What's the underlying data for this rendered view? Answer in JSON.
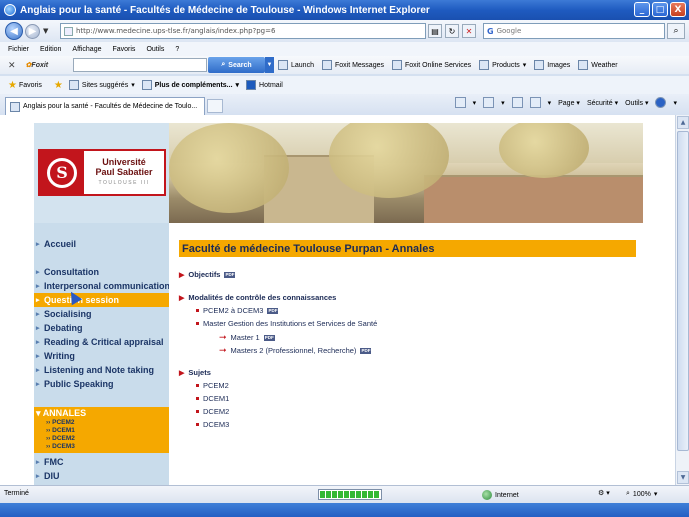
{
  "window": {
    "title": "Anglais pour la santé - Facultés de Médecine de Toulouse - Windows Internet Explorer",
    "min_glyph": "_",
    "max_glyph": "□",
    "close_glyph": "X"
  },
  "addressbar": {
    "url": "http://www.medecine.ups-tlse.fr/anglais/index.php?pg=6",
    "search_placeholder": "Google"
  },
  "menu": [
    "Fichier",
    "Edition",
    "Affichage",
    "Favoris",
    "Outils",
    "?"
  ],
  "foxit": {
    "logo": "Foxit",
    "search_label": "Search",
    "items": [
      "Launch",
      "Foxit Messages",
      "Foxit Online Services",
      "Products",
      "Images",
      "Weather"
    ]
  },
  "favorites": {
    "label": "Favoris",
    "items": [
      "Sites suggérés",
      "Plus de compléments...",
      "Hotmail"
    ]
  },
  "tab": {
    "label": "Anglais pour la santé - Facultés de Médecine de Toulo..."
  },
  "commandbar": [
    "Page",
    "Sécurité",
    "Outils"
  ],
  "logo": {
    "line1": "Université",
    "line2": "Paul Sabatier",
    "line3": "TOULOUSE III",
    "seal_letter": "S"
  },
  "nav": {
    "home": "Accueil",
    "items": [
      "Consultation",
      "Interpersonal communication",
      "Question session",
      "Socialising",
      "Debating",
      "Reading & Critical appraisal",
      "Writing",
      "Listening and Note taking",
      "Public Speaking"
    ],
    "active_index": 2,
    "annales": {
      "title": "ANNALES",
      "items": [
        "›› PCEM2",
        "›› DCEM1",
        "›› DCEM2",
        "›› DCEM3"
      ]
    },
    "bottom": [
      "FMC",
      "DIU"
    ]
  },
  "content": {
    "title": "Faculté de médecine Toulouse Purpan - Annales",
    "sections": {
      "objectifs": "Objectifs",
      "modalites": "Modalités de contrôle des connaissances",
      "pcem_dcem": "PCEM2 à DCEM3",
      "master_gestion": "Master Gestion des Institutions et Services de Santé",
      "master1": "Master 1",
      "masters2": "Masters 2 (Professionnel, Recherche)",
      "sujets": "Sujets",
      "sujets_items": [
        "PCEM2",
        "DCEM1",
        "DCEM2",
        "DCEM3"
      ]
    },
    "pdf_badge": "PDF"
  },
  "statusbar": {
    "text": "Terminé",
    "zone": "Internet",
    "zoom": "100%",
    "progress": 1.0
  }
}
